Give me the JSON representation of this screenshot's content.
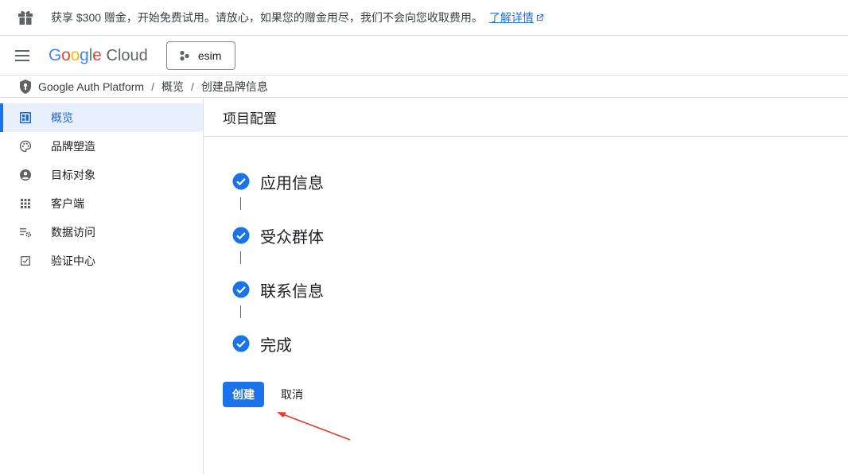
{
  "promo": {
    "icon": "gift-icon",
    "text": "获享 $300 赠金，开始免费试用。请放心，如果您的赠金用尽，我们不会向您收取费用。",
    "link_label": "了解详情"
  },
  "topbar": {
    "menu_icon": "hamburger-menu-icon",
    "logo_google": "Google",
    "logo_cloud": "Cloud",
    "project_name": "esim"
  },
  "breadcrumb": {
    "items": [
      "Google Auth Platform",
      "概览",
      "创建品牌信息"
    ],
    "separator": "/"
  },
  "sidebar": {
    "items": [
      {
        "label": "概览",
        "icon": "dashboard-icon",
        "active": true
      },
      {
        "label": "品牌塑造",
        "icon": "palette-icon",
        "active": false
      },
      {
        "label": "目标对象",
        "icon": "account-circle-icon",
        "active": false
      },
      {
        "label": "客户端",
        "icon": "apps-grid-icon",
        "active": false
      },
      {
        "label": "数据访问",
        "icon": "data-settings-icon",
        "active": false
      },
      {
        "label": "验证中心",
        "icon": "verified-checkbox-icon",
        "active": false
      }
    ]
  },
  "main": {
    "title": "项目配置",
    "steps": [
      {
        "label": "应用信息",
        "status": "complete"
      },
      {
        "label": "受众群体",
        "status": "complete"
      },
      {
        "label": "联系信息",
        "status": "complete"
      },
      {
        "label": "完成",
        "status": "complete"
      }
    ],
    "create_label": "创建",
    "cancel_label": "取消"
  },
  "colors": {
    "accent": "#1a73e8",
    "active_bg": "#e8f0fe",
    "annotation_arrow": "#e8392f",
    "border": "#dadce0"
  }
}
